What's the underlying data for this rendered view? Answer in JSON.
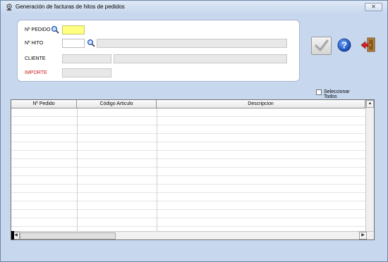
{
  "window": {
    "title": "Generación  de facturas de hitos de pedidos",
    "close_glyph": "✕"
  },
  "form": {
    "pedido_label": "Nº PEDIDO",
    "pedido_value": "",
    "hito_label": "Nº HITO",
    "hito_value": "",
    "hito_desc": "",
    "cliente_label": "CLIENTE",
    "cliente_code": "",
    "cliente_name": "",
    "importe_label": "IMPORTE",
    "importe_value": ""
  },
  "icons": {
    "search": "search-icon",
    "confirm": "checkmark-icon",
    "help": "help-icon",
    "exit": "exit-door-icon",
    "app": "app-icon"
  },
  "select_all": {
    "label": "Seleccionar Todos",
    "checked": false
  },
  "grid": {
    "columns": [
      "Nº Pedido",
      "Código Articulo",
      "Descripcion"
    ],
    "rows": []
  },
  "colors": {
    "highlight_input": "#ffff80",
    "importe_label": "#d02020",
    "window_bg": "#c7d7ee"
  }
}
